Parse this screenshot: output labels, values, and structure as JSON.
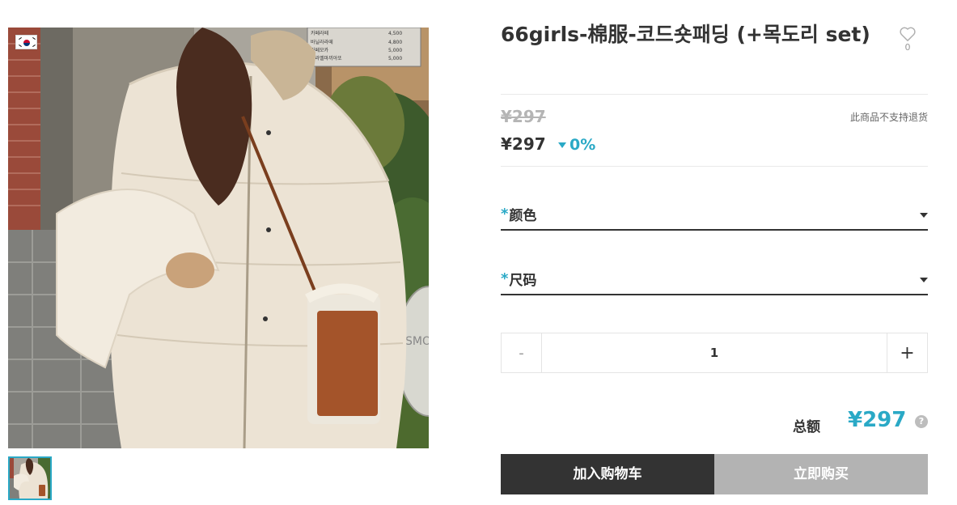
{
  "product": {
    "title": "66girls-棉服-코드숏패딩 (+목도리 set)",
    "like_count": "0",
    "original_price": "¥297",
    "price": "¥297",
    "discount": "0%",
    "return_note": "此商品不支持退货"
  },
  "options": [
    {
      "required_mark": "*",
      "label": "颜色"
    },
    {
      "required_mark": "*",
      "label": "尺码"
    }
  ],
  "quantity": {
    "minus_label": "-",
    "value": "1",
    "plus_label": "+"
  },
  "total": {
    "label": "总额",
    "amount": "¥297",
    "help_label": "?"
  },
  "actions": {
    "add_to_cart": "加入购物车",
    "buy_now": "立即购买"
  },
  "photo_sign": {
    "menu": [
      {
        "name": "카페라떼",
        "price": "4,500"
      },
      {
        "name": "바닐라라떼",
        "price": "4,800"
      },
      {
        "name": "카페모카",
        "price": "5,000"
      },
      {
        "name": "카라멜마끼아또",
        "price": "5,000"
      }
    ],
    "sign_text": "SMO"
  },
  "colors": {
    "accent": "#2aa9c6",
    "cart_button": "#333333",
    "buy_button": "#b3b3b3"
  },
  "icons": [
    "korea-flag-icon",
    "heart-icon",
    "caret-down-icon",
    "help-icon"
  ]
}
